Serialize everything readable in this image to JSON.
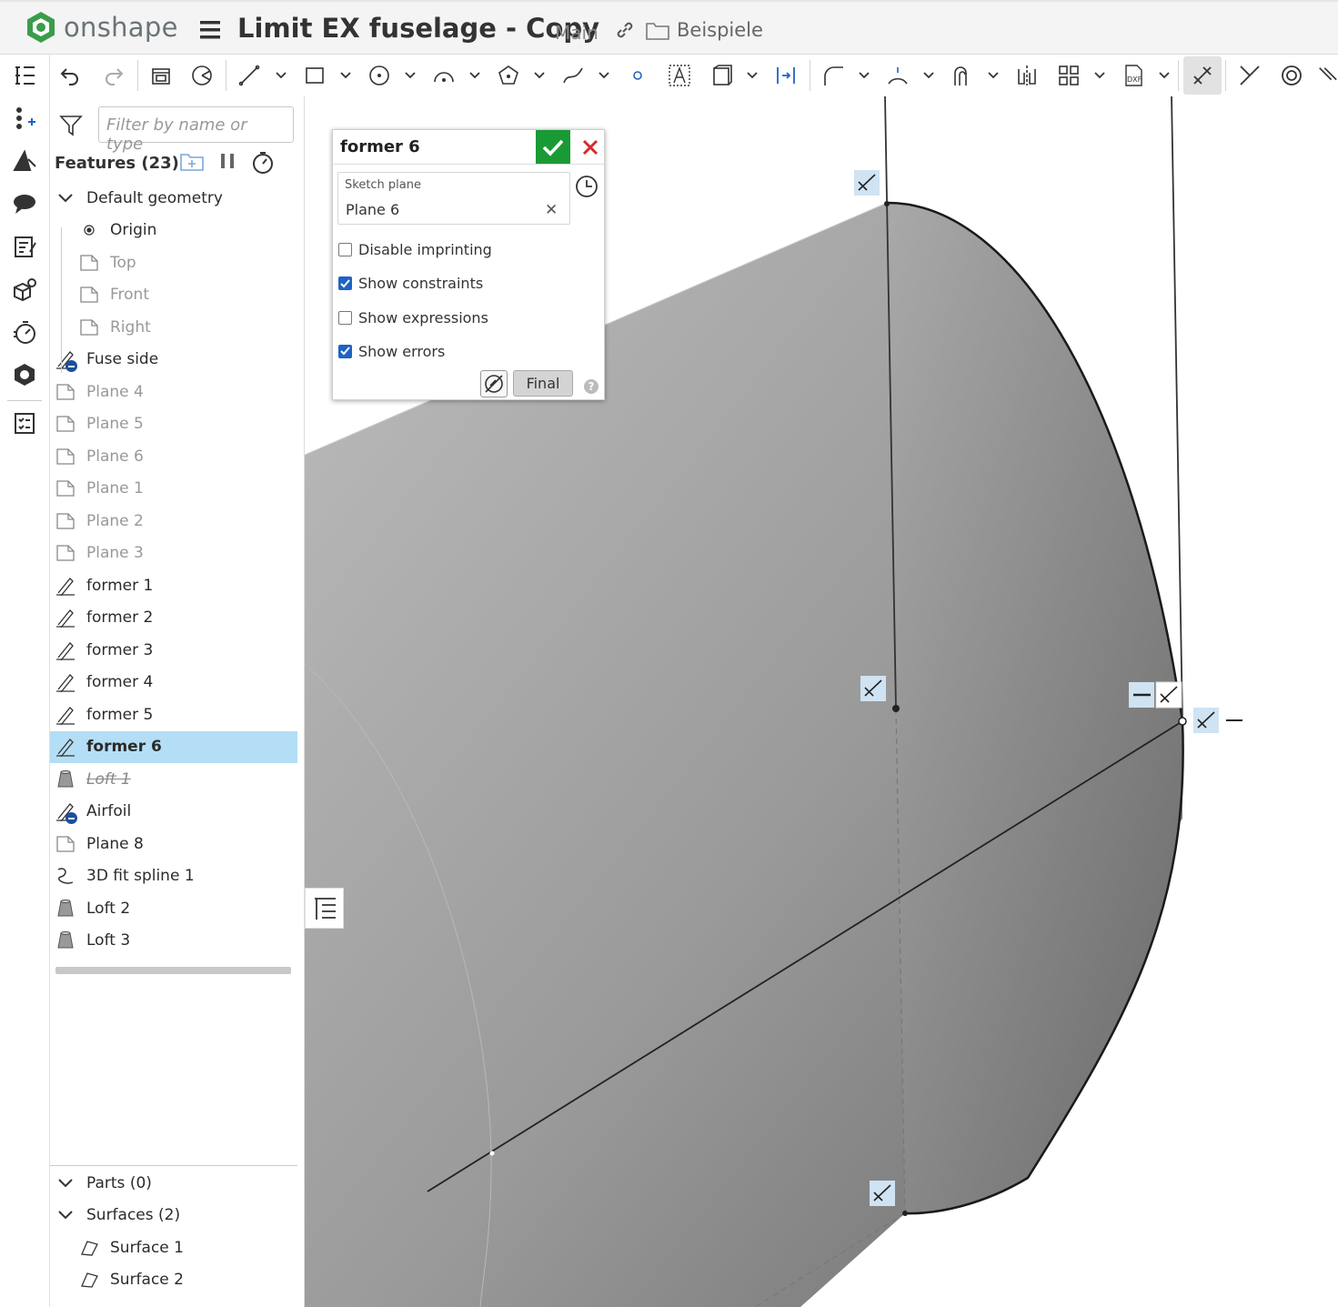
{
  "app": {
    "logo_text": "onshape",
    "doc_title": "Limit EX fuselage - Copy",
    "branch": "Main",
    "folder": "Beispiele"
  },
  "feature_panel": {
    "filter_placeholder": "Filter by name or type",
    "features_header": "Features (23)",
    "items": [
      {
        "label": "Default geometry",
        "type": "group"
      },
      {
        "label": "Origin",
        "type": "origin"
      },
      {
        "label": "Top",
        "type": "plane",
        "dim": true
      },
      {
        "label": "Front",
        "type": "plane",
        "dim": true
      },
      {
        "label": "Right",
        "type": "plane",
        "dim": true
      },
      {
        "label": "Fuse side",
        "type": "sketch-error"
      },
      {
        "label": "Plane 4",
        "type": "plane",
        "dim": true
      },
      {
        "label": "Plane 5",
        "type": "plane",
        "dim": true
      },
      {
        "label": "Plane 6",
        "type": "plane",
        "dim": true
      },
      {
        "label": "Plane 1",
        "type": "plane",
        "dim": true
      },
      {
        "label": "Plane 2",
        "type": "plane",
        "dim": true
      },
      {
        "label": "Plane 3",
        "type": "plane",
        "dim": true
      },
      {
        "label": "former 1",
        "type": "sketch"
      },
      {
        "label": "former 2",
        "type": "sketch"
      },
      {
        "label": "former 3",
        "type": "sketch"
      },
      {
        "label": "former 4",
        "type": "sketch"
      },
      {
        "label": "former 5",
        "type": "sketch"
      },
      {
        "label": "former 6",
        "type": "sketch",
        "selected": true
      },
      {
        "label": "Loft 1",
        "type": "loft",
        "suppressed": true
      },
      {
        "label": "Airfoil",
        "type": "sketch-error"
      },
      {
        "label": "Plane 8",
        "type": "plane"
      },
      {
        "label": "3D fit spline 1",
        "type": "spline"
      },
      {
        "label": "Loft 2",
        "type": "loft"
      },
      {
        "label": "Loft 3",
        "type": "loft"
      }
    ],
    "parts": [
      {
        "label": "Parts (0)",
        "type": "group"
      },
      {
        "label": "Surfaces (2)",
        "type": "group"
      },
      {
        "label": "Surface 1",
        "type": "surface"
      },
      {
        "label": "Surface 2",
        "type": "surface"
      }
    ]
  },
  "sketch_dialog": {
    "title": "former 6",
    "sketch_plane_caption": "Sketch plane",
    "sketch_plane_value": "Plane 6",
    "options": [
      {
        "label": "Disable imprinting",
        "checked": false
      },
      {
        "label": "Show constraints",
        "checked": true
      },
      {
        "label": "Show expressions",
        "checked": false
      },
      {
        "label": "Show errors",
        "checked": true
      }
    ],
    "final_label": "Final",
    "help": "?"
  },
  "colors": {
    "accent_green": "#1a9a35",
    "selected_row": "#b4def5",
    "logo_green": "#3a9d4a",
    "badge_blue": "#1d4f9b"
  }
}
